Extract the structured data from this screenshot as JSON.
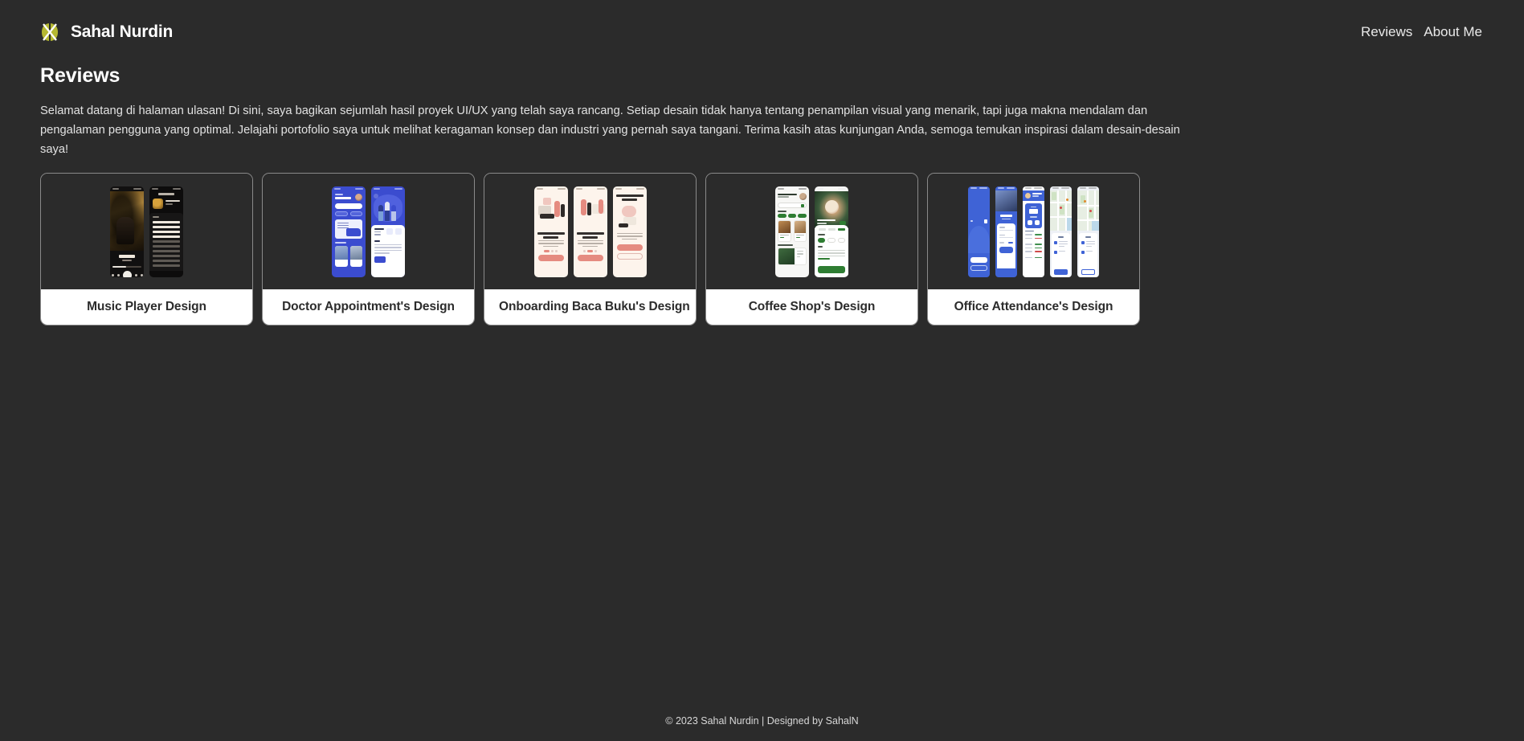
{
  "header": {
    "logo_icon": "butterfly-x-logo-icon",
    "brand_name": "Sahal Nurdin",
    "nav": [
      {
        "label": "Reviews"
      },
      {
        "label": "About Me"
      }
    ]
  },
  "main": {
    "title": "Reviews",
    "intro": "Selamat datang di halaman ulasan! Di sini, saya bagikan sejumlah hasil proyek UI/UX yang telah saya rancang. Setiap desain tidak hanya tentang penampilan visual yang menarik, tapi juga makna mendalam dan pengalaman pengguna yang optimal. Jelajahi portofolio saya untuk melihat keragaman konsep dan industri yang pernah saya tangani. Terima kasih atas kunjungan Anda, semoga temukan inspirasi dalam desain-desain saya!",
    "cards": [
      {
        "label": "Music Player Design"
      },
      {
        "label": "Doctor Appointment's Design"
      },
      {
        "label": "Onboarding Baca Buku's Design"
      },
      {
        "label": "Coffee Shop's Design"
      },
      {
        "label": "Office Attendance's Design"
      }
    ]
  },
  "footer": {
    "copyright": "© 2023 Sahal Nurdin | Designed by SahalN"
  },
  "colors": {
    "page_background": "#2b2b2b",
    "card_border": "#8a8a8a",
    "card_label_background": "#ffffff",
    "card_label_text": "#2c2c2c",
    "text_primary": "#ffffff",
    "text_body": "#e2e2e2",
    "logo_accent": "#b5b832"
  }
}
